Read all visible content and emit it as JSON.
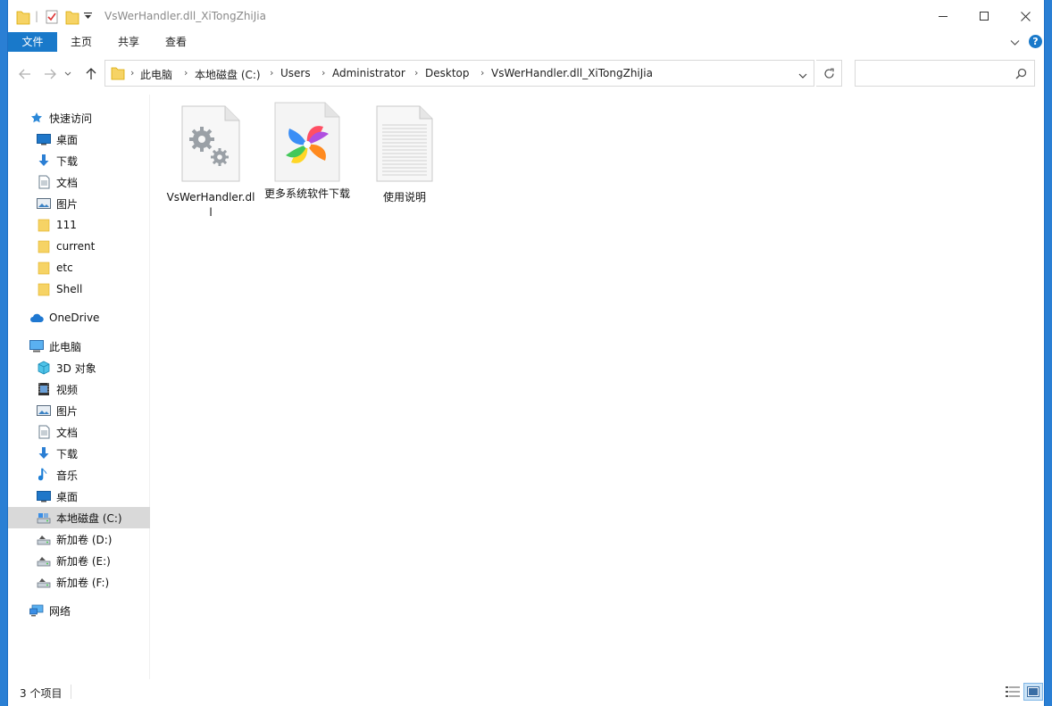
{
  "window": {
    "title": "VsWerHandler.dll_XiTongZhiJia"
  },
  "ribbon": {
    "tabs": [
      "文件",
      "主页",
      "共享",
      "查看"
    ],
    "help_label": "?"
  },
  "address": {
    "crumbs": [
      "此电脑",
      "本地磁盘 (C:)",
      "Users",
      "Administrator",
      "Desktop",
      "VsWerHandler.dll_XiTongZhiJia"
    ]
  },
  "search": {
    "placeholder": ""
  },
  "nav": {
    "quick_access": "快速访问",
    "quick_items": [
      {
        "label": "桌面",
        "icon": "desktop-icon",
        "pinned": true
      },
      {
        "label": "下载",
        "icon": "download-icon",
        "pinned": true
      },
      {
        "label": "文档",
        "icon": "document-icon",
        "pinned": true
      },
      {
        "label": "图片",
        "icon": "pictures-icon",
        "pinned": true
      },
      {
        "label": "111",
        "icon": "folder-icon",
        "pinned": false
      },
      {
        "label": "current",
        "icon": "folder-icon",
        "pinned": false
      },
      {
        "label": "etc",
        "icon": "folder-icon",
        "pinned": false
      },
      {
        "label": "Shell",
        "icon": "folder-icon",
        "pinned": false
      }
    ],
    "onedrive": "OneDrive",
    "this_pc": "此电脑",
    "pc_items": [
      {
        "label": "3D 对象",
        "icon": "3d-objects-icon"
      },
      {
        "label": "视频",
        "icon": "video-icon"
      },
      {
        "label": "图片",
        "icon": "pictures-icon"
      },
      {
        "label": "文档",
        "icon": "document-icon"
      },
      {
        "label": "下载",
        "icon": "download-icon"
      },
      {
        "label": "音乐",
        "icon": "music-icon"
      },
      {
        "label": "桌面",
        "icon": "desktop-icon"
      },
      {
        "label": "本地磁盘 (C:)",
        "icon": "drive-icon",
        "selected": true
      },
      {
        "label": "新加卷 (D:)",
        "icon": "drive-icon"
      },
      {
        "label": "新加卷 (E:)",
        "icon": "drive-icon"
      },
      {
        "label": "新加卷 (F:)",
        "icon": "drive-icon"
      }
    ],
    "network": "网络"
  },
  "files": [
    {
      "label": "VsWerHandler.dll",
      "icon": "dll-file-icon"
    },
    {
      "label": "更多系统软件下载",
      "icon": "browser-shortcut-icon"
    },
    {
      "label": "使用说明",
      "icon": "text-file-icon"
    }
  ],
  "status": {
    "count_text": "3 个项目"
  }
}
